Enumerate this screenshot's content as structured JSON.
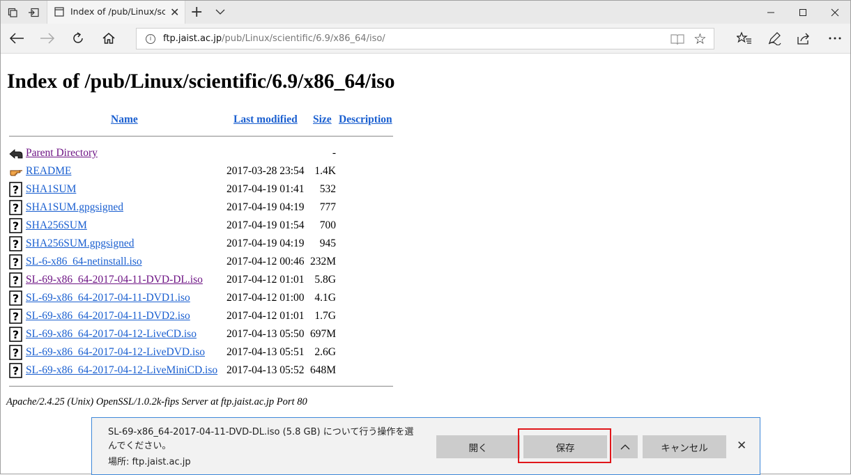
{
  "browser": {
    "tab_title": "Index of /pub/Linux/scie",
    "url_host": "ftp.jaist.ac.jp",
    "url_path": "/pub/Linux/scientific/6.9/x86_64/iso/"
  },
  "page": {
    "title": "Index of /pub/Linux/scientific/6.9/x86_64/iso",
    "columns": {
      "name": "Name",
      "last_modified": "Last modified",
      "size": "Size",
      "description": "Description"
    },
    "rows": [
      {
        "icon": "back-icon",
        "name": "Parent Directory",
        "date": "",
        "size": "-",
        "visited": true
      },
      {
        "icon": "hand-icon",
        "name": "README",
        "date": "2017-03-28 23:54",
        "size": "1.4K",
        "visited": false
      },
      {
        "icon": "unknown-file-icon",
        "name": "SHA1SUM",
        "date": "2017-04-19 01:41",
        "size": "532",
        "visited": false
      },
      {
        "icon": "unknown-file-icon",
        "name": "SHA1SUM.gpgsigned",
        "date": "2017-04-19 04:19",
        "size": "777",
        "visited": false
      },
      {
        "icon": "unknown-file-icon",
        "name": "SHA256SUM",
        "date": "2017-04-19 01:54",
        "size": "700",
        "visited": false
      },
      {
        "icon": "unknown-file-icon",
        "name": "SHA256SUM.gpgsigned",
        "date": "2017-04-19 04:19",
        "size": "945",
        "visited": false
      },
      {
        "icon": "unknown-file-icon",
        "name": "SL-6-x86_64-netinstall.iso",
        "date": "2017-04-12 00:46",
        "size": "232M",
        "visited": false
      },
      {
        "icon": "unknown-file-icon",
        "name": "SL-69-x86_64-2017-04-11-DVD-DL.iso",
        "date": "2017-04-12 01:01",
        "size": "5.8G",
        "visited": true
      },
      {
        "icon": "unknown-file-icon",
        "name": "SL-69-x86_64-2017-04-11-DVD1.iso",
        "date": "2017-04-12 01:00",
        "size": "4.1G",
        "visited": false
      },
      {
        "icon": "unknown-file-icon",
        "name": "SL-69-x86_64-2017-04-11-DVD2.iso",
        "date": "2017-04-12 01:01",
        "size": "1.7G",
        "visited": false
      },
      {
        "icon": "unknown-file-icon",
        "name": "SL-69-x86_64-2017-04-12-LiveCD.iso",
        "date": "2017-04-13 05:50",
        "size": "697M",
        "visited": false
      },
      {
        "icon": "unknown-file-icon",
        "name": "SL-69-x86_64-2017-04-12-LiveDVD.iso",
        "date": "2017-04-13 05:51",
        "size": "2.6G",
        "visited": false
      },
      {
        "icon": "unknown-file-icon",
        "name": "SL-69-x86_64-2017-04-12-LiveMiniCD.iso",
        "date": "2017-04-13 05:52",
        "size": "648M",
        "visited": false
      }
    ],
    "server_signature": "Apache/2.4.25 (Unix) OpenSSL/1.0.2k-fips Server at ftp.jaist.ac.jp Port 80"
  },
  "download_bar": {
    "message": "SL-69-x86_64-2017-04-11-DVD-DL.iso (5.8 GB) について行う操作を選んでください。",
    "location": "場所: ftp.jaist.ac.jp",
    "open_label": "開く",
    "save_label": "保存",
    "more_label": "^",
    "cancel_label": "キャンセル",
    "close_label": "✕"
  },
  "colors": {
    "link": "#1a5fd0",
    "visited_link": "#6e1585",
    "download_bar_border": "#3d87d8",
    "save_highlight": "#e0161a"
  }
}
